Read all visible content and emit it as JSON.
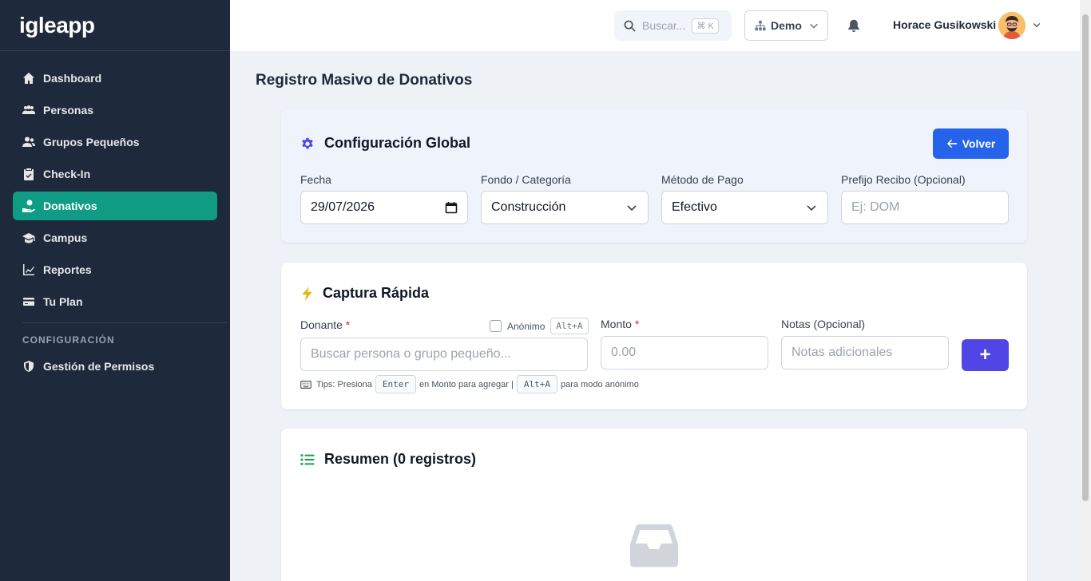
{
  "sidebar": {
    "brand": "igleapp",
    "items": [
      {
        "label": "Dashboard",
        "icon": "home-icon"
      },
      {
        "label": "Personas",
        "icon": "users-icon"
      },
      {
        "label": "Grupos Pequeños",
        "icon": "user-group-icon"
      },
      {
        "label": "Check-In",
        "icon": "clipboard-check-icon"
      },
      {
        "label": "Donativos",
        "icon": "hand-holding-dollar-icon",
        "active": true
      },
      {
        "label": "Campus",
        "icon": "graduation-cap-icon"
      },
      {
        "label": "Reportes",
        "icon": "chart-line-icon"
      },
      {
        "label": "Tu Plan",
        "icon": "credit-card-icon"
      }
    ],
    "section_label": "CONFIGURACIÓN",
    "section_items": [
      {
        "label": "Gestión de Permisos",
        "icon": "shield-icon"
      }
    ]
  },
  "topbar": {
    "search_placeholder": "Buscar...",
    "search_shortcut": "⌘ K",
    "org_selector": "Demo",
    "user_name": "Horace Gusikowski"
  },
  "page": {
    "title": "Registro Masivo de Donativos"
  },
  "global_config": {
    "title": "Configuración Global",
    "back_label": "Volver",
    "fecha_label": "Fecha",
    "fecha_value": "29/07/2026",
    "fondo_label": "Fondo / Categoría",
    "fondo_value": "Construcción",
    "metodo_label": "Método de Pago",
    "metodo_value": "Efectivo",
    "prefijo_label": "Prefijo Recibo (Opcional)",
    "prefijo_placeholder": "Ej: DOM"
  },
  "quick_capture": {
    "title": "Captura Rápida",
    "donante_label": "Donante",
    "required_mark": "*",
    "anon_label": "Anónimo",
    "anon_shortcut": "Alt+A",
    "donante_placeholder": "Buscar persona o grupo pequeño...",
    "monto_label": "Monto",
    "monto_placeholder": "0.00",
    "notas_label": "Notas (Opcional)",
    "notas_placeholder": "Notas adicionales",
    "add_label": "+",
    "tips_prefix": "Tips: Presiona",
    "tips_key1": "Enter",
    "tips_middle": "en Monto para agregar |",
    "tips_key2": "Alt+A",
    "tips_suffix": "para modo anónimo"
  },
  "summary": {
    "title": "Resumen (0 registros)"
  },
  "colors": {
    "sidebar_bg": "#1e293b",
    "active_item": "#0f9b84",
    "primary_blue": "#2563eb",
    "indigo": "#4f46e5",
    "gear_color": "#4f46e5",
    "bolt_color": "#eab308",
    "list_color": "#16a34a"
  }
}
